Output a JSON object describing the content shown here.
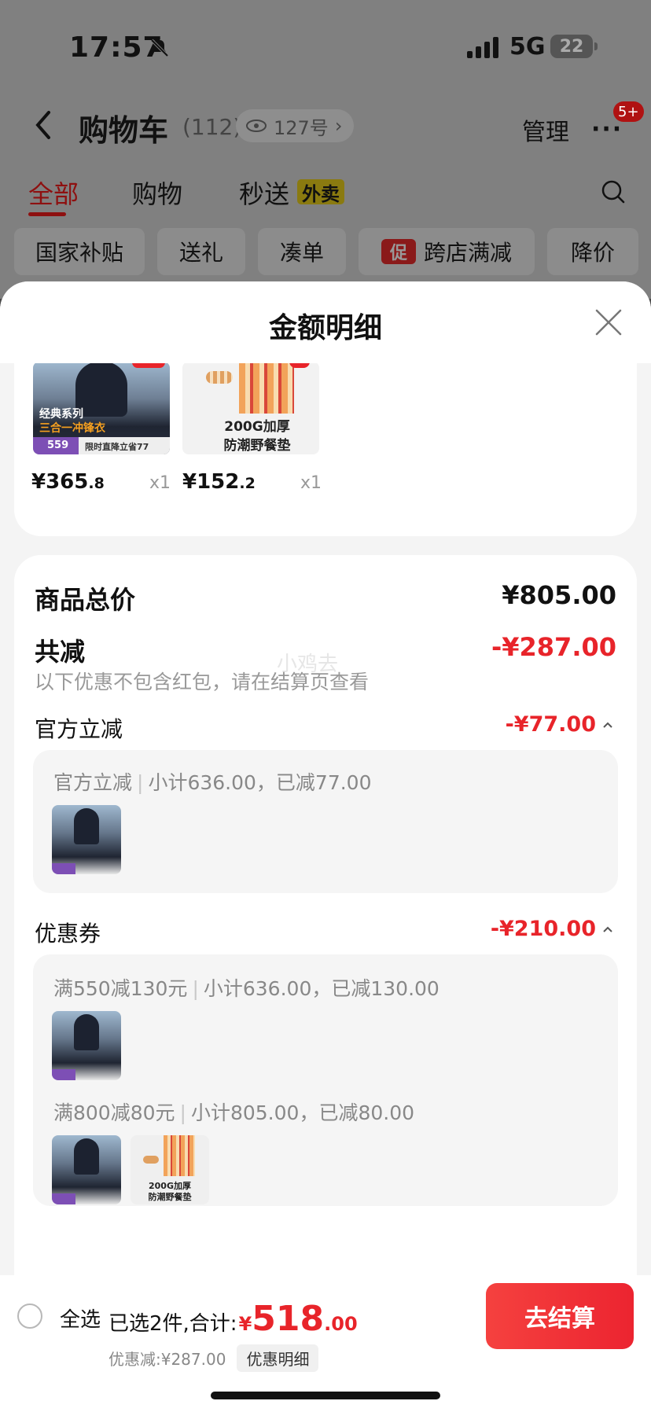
{
  "status_bar": {
    "time": "17:57",
    "network": "5G",
    "battery": "22"
  },
  "header": {
    "title": "购物车",
    "count": "(112)",
    "viewer_label": "127号",
    "manage_label": "管理",
    "more_badge": "5+"
  },
  "tabs": [
    {
      "label": "全部",
      "active": true
    },
    {
      "label": "购物",
      "active": false
    },
    {
      "label": "秒送",
      "active": false
    }
  ],
  "takeout_badge": "外卖",
  "chips": [
    "国家补贴",
    "送礼",
    "凑单",
    "跨店满减",
    "降价"
  ],
  "promo_icon_text": "促",
  "sheet": {
    "title": "金额明细",
    "items": [
      {
        "price_int": "¥365",
        "price_dec": ".8",
        "qty": "x1",
        "thumb_text": "经典系列",
        "thumb_sub": "三合一冲锋衣",
        "thumb_price": "559",
        "thumb_banner": "限时直降立省77"
      },
      {
        "price_int": "¥152",
        "price_dec": ".2",
        "qty": "x1",
        "thumb_text": "200G加厚",
        "thumb_sub": "防潮野餐垫"
      }
    ],
    "summary": {
      "total_label": "商品总价",
      "total_value": "¥805.00",
      "reduce_label": "共减",
      "reduce_value": "-¥287.00",
      "note": "以下优惠不包含红包，请在结算页查看",
      "watermark": "小鸡去",
      "official": {
        "label": "官方立减",
        "value": "-¥77.00",
        "line_name": "官方立减",
        "line_detail": "小计636.00，已减77.00"
      },
      "coupon": {
        "label": "优惠券",
        "value": "-¥210.00",
        "line1_name": "满550减130元",
        "line1_detail": "小计636.00，已减130.00",
        "line2_name": "满800减80元",
        "line2_detail": "小计805.00，已减80.00"
      }
    }
  },
  "bottom_bar": {
    "select_all": "全选",
    "selected_text": "已选2件,合计:",
    "yen": "¥",
    "amount_int": "518",
    "amount_dec": ".00",
    "discount_text": "优惠减:¥287.00",
    "detail_label": "优惠明细",
    "checkout_label": "去结算"
  },
  "colors": {
    "accent_red": "#e8242a",
    "checkout_red": "#f5413f"
  }
}
